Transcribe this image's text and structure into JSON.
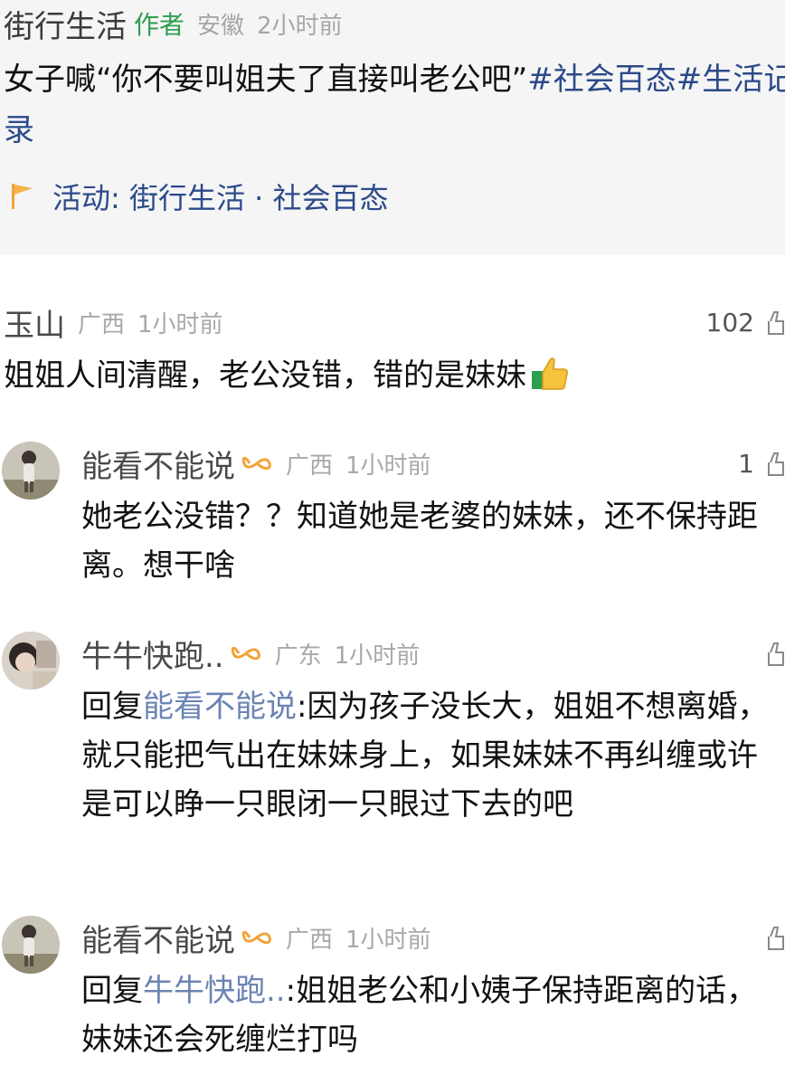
{
  "post": {
    "author": "街行生活",
    "author_tag": "作者",
    "location": "安徽",
    "time": "2小时前",
    "title_prefix": "女子喊“你不要叫姐夫了直接叫老公吧”",
    "hashtags": "#社会百态#生活记录",
    "activity_label": "活动: 街行生活 · 社会百态",
    "activity_icon": "flag-icon",
    "accent_color": "#2c4a8a"
  },
  "comments": [
    {
      "name": "玉山",
      "location": "广西",
      "time": "1小时前",
      "likes": "102",
      "text": "姐姐人间清醒，老公没错，错的是妹妹",
      "emoji": "thumbs-up-emoji"
    },
    {
      "name": "能看不能说",
      "location": "广西",
      "time": "1小时前",
      "likes": "1",
      "badge": "infinity-badge-icon",
      "text": "她老公没错？？知道她是老婆的妹妹，还不保持距离。想干啥"
    },
    {
      "name": "牛牛快跑..",
      "location": "广东",
      "time": "1小时前",
      "likes": "",
      "badge": "infinity-badge-icon",
      "reply_prefix": "回复",
      "reply_to": "能看不能说",
      "text": ":因为孩子没长大，姐姐不想离婚，就只能把气出在妹妹身上，如果妹妹不再纠缠或许是可以睁一只眼闭一只眼过下去的吧"
    },
    {
      "name": "能看不能说",
      "location": "广西",
      "time": "1小时前",
      "likes": "",
      "badge": "infinity-badge-icon",
      "reply_prefix": "回复",
      "reply_to": "牛牛快跑..",
      "text": ":姐姐老公和小姨子保持距离的话，妹妹还会死缠烂打吗"
    }
  ]
}
